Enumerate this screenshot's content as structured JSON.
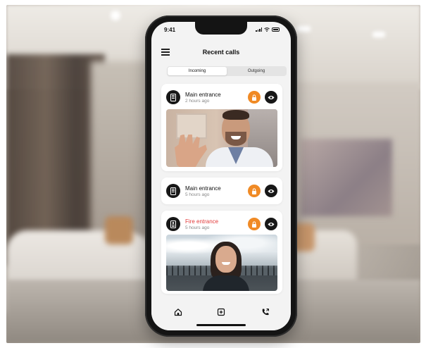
{
  "status_bar": {
    "time": "9:41"
  },
  "header": {
    "title": "Recent calls",
    "menu_icon": "hamburger-menu-icon"
  },
  "tabs": [
    {
      "label": "Incoming",
      "active": true
    },
    {
      "label": "Outgoing",
      "active": false
    }
  ],
  "calls": [
    {
      "name": "Main entrance",
      "time": "2 hours ago",
      "icon": "door-phone-icon",
      "has_snapshot": true,
      "alert": false
    },
    {
      "name": "Main entrance",
      "time": "5 hours ago",
      "icon": "door-phone-icon",
      "has_snapshot": false,
      "alert": false
    },
    {
      "name": "Fire entrance",
      "time": "5 hours ago",
      "icon": "door-phone-icon",
      "has_snapshot": true,
      "alert": true
    }
  ],
  "bottom_nav": [
    "home-icon",
    "add-device-icon",
    "phone-calls-icon"
  ],
  "colors": {
    "accent": "#f08a25",
    "alert": "#e23a3a",
    "dark": "#171717",
    "screen_bg": "#f3f3f3"
  }
}
